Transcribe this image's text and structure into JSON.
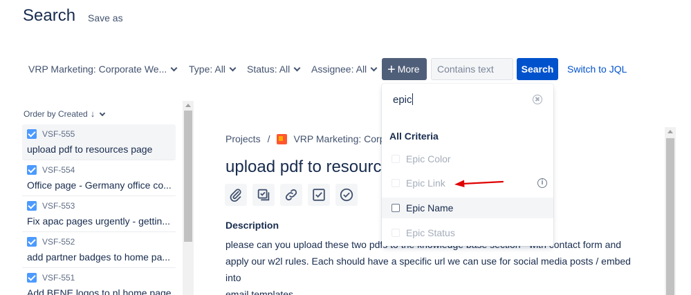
{
  "header": {
    "title": "Search",
    "save_as": "Save as"
  },
  "filters": {
    "project": "VRP Marketing: Corporate We...",
    "type": "Type: All",
    "status": "Status: All",
    "assignee": "Assignee: All",
    "more_label": "More",
    "text_placeholder": "Contains text",
    "search_label": "Search",
    "jql_link": "Switch to JQL"
  },
  "sidebar": {
    "order_by": "Order by Created",
    "issues": [
      {
        "key": "VSF-555",
        "summary": "upload pdf to resources page"
      },
      {
        "key": "VSF-554",
        "summary": "Office page - Germany office co..."
      },
      {
        "key": "VSF-553",
        "summary": "Fix apac pages urgently - gettin..."
      },
      {
        "key": "VSF-552",
        "summary": "add partner badges to home pa..."
      },
      {
        "key": "VSF-551",
        "summary": "Add BENE logos to nl home page"
      }
    ]
  },
  "issue": {
    "breadcrumb_projects": "Projects",
    "breadcrumb_sep": "/",
    "breadcrumb_project": "VRP Marketing: Corpo",
    "title": "upload pdf to resourc",
    "description_label": "Description",
    "description_lines": [
      "please can you upload these two pdfs to the knowledge base section - with contact form and",
      "apply our w2l rules. Each should have a specific url we can use for social media posts / embed into",
      "email templates."
    ]
  },
  "criteria_dropdown": {
    "search_value": "epic",
    "heading": "All Criteria",
    "options": [
      {
        "label": "Epic Color",
        "enabled": false
      },
      {
        "label": "Epic Link",
        "enabled": false,
        "info": "i"
      },
      {
        "label": "Epic Name",
        "enabled": true
      },
      {
        "label": "Epic Status",
        "enabled": false
      }
    ]
  },
  "colors": {
    "primary": "#0052cc",
    "more_button": "#505f79",
    "checkbox": "#4c9aff",
    "annotation_arrow": "#e00000"
  }
}
